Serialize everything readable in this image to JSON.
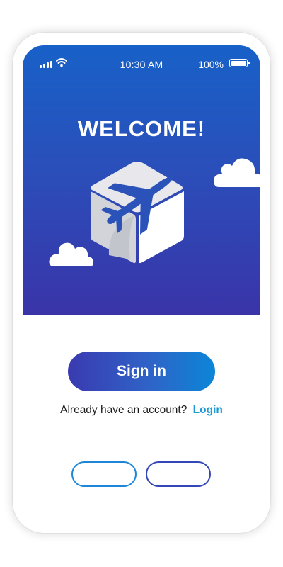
{
  "status_bar": {
    "time": "10:30 AM",
    "battery_percent": "100%",
    "battery_level": 1.0
  },
  "hero": {
    "title": "WELCOME!",
    "illustration": "box-with-airplane",
    "decorations": [
      "cloud-icon",
      "cloud-icon"
    ]
  },
  "auth": {
    "sign_in_label": "Sign in",
    "account_prompt": "Already have an account?",
    "login_link": "Login"
  },
  "bottom_buttons": {
    "left_label": "",
    "right_label": ""
  },
  "colors": {
    "hero_top": "#1761c8",
    "hero_bottom": "#3a34a8",
    "accent_link": "#1c9bd6",
    "button_gradient_start": "#3a3ab0",
    "button_gradient_end": "#0b86d8"
  }
}
